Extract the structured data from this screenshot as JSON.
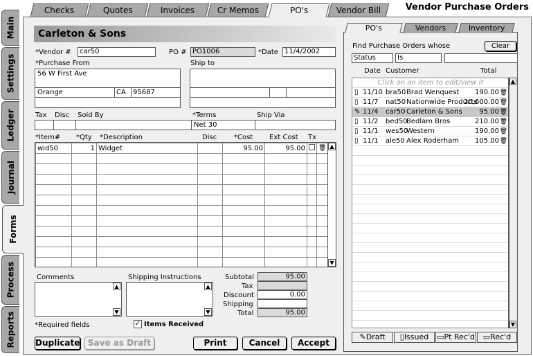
{
  "top_tabs": [
    {
      "label": "Checks"
    },
    {
      "label": "Quotes"
    },
    {
      "label": "Invoices"
    },
    {
      "label": "Cr Memos"
    },
    {
      "label": "PO's"
    },
    {
      "label": "Vendor Bill"
    }
  ],
  "app_title": "Vendor Purchase Orders",
  "side_tabs": [
    {
      "label": "Main"
    },
    {
      "label": "Settings"
    },
    {
      "label": "Ledger"
    },
    {
      "label": "Journal"
    },
    {
      "label": "Forms"
    },
    {
      "label": "Process"
    },
    {
      "label": "Reports"
    }
  ],
  "form": {
    "vendor_name": "Carleton & Sons",
    "vendor_label": "*Vendor #",
    "vendor_value": "car50",
    "po_label": "PO #",
    "po_value": "PO1006",
    "date_label": "*Date",
    "date_value": "11/4/2002",
    "purchase_from_label": "*Purchase From",
    "address1": "56 W First Ave",
    "city": "Orange",
    "state": "CA",
    "zip": "95687",
    "ship_to_label": "Ship to",
    "tax_label": "Tax",
    "disc_label": "Disc",
    "sold_by_label": "Sold By",
    "terms_label": "*Terms",
    "terms_value": "Net 30",
    "ship_via_label": "Ship Via",
    "columns": {
      "item": "*Item#",
      "qty": "*Qty",
      "desc": "*Description",
      "disc": "Disc",
      "cost": "*Cost",
      "ext": "Ext Cost",
      "tx": "Tx"
    },
    "lines": [
      {
        "item": "wid50",
        "qty": "1",
        "desc": "Widget",
        "disc": "",
        "cost": "95.00",
        "ext": "95.00"
      }
    ],
    "comments_label": "Comments",
    "shipping_instr_label": "Shipping Instructions",
    "subtotal_label": "Subtotal",
    "subtotal": "95.00",
    "tax_total_label": "Tax",
    "tax_total": "",
    "discount_label": "Discount",
    "discount": "0.00",
    "shipping_label": "Shipping",
    "shipping": "",
    "total_label": "Total",
    "total": "95.00",
    "required_note": "*Required fields",
    "items_received_label": "Items Received",
    "items_received_check": "✓"
  },
  "buttons": {
    "duplicate": "Duplicate",
    "save_draft": "Save as Draft",
    "print": "Print",
    "cancel": "Cancel",
    "accept": "Accept"
  },
  "right": {
    "tabs": [
      {
        "label": "PO's"
      },
      {
        "label": "Vendors"
      },
      {
        "label": "Inventory"
      }
    ],
    "find_label": "Find Purchase Orders whose",
    "clear": "Clear",
    "filter_field": "Status",
    "filter_op": "Is",
    "filter_value": "",
    "col_date": "Date",
    "col_customer": "Customer",
    "col_total": "Total",
    "hint": "Click on an item to edit/view it",
    "rows": [
      {
        "date": "11/10",
        "code": "bra50",
        "name": "Brad Wenquest",
        "total": "190.00",
        "selected": false
      },
      {
        "date": "11/7",
        "code": "nat50",
        "name": "Nationwide Products",
        "total": "20,600.00",
        "selected": false
      },
      {
        "date": "11/4",
        "code": "car50",
        "name": "Carleton & Sons",
        "total": "95.00",
        "selected": true
      },
      {
        "date": "11/2",
        "code": "bed50",
        "name": "Bedlam Bros",
        "total": "210.00",
        "selected": false
      },
      {
        "date": "11/1",
        "code": "wes50",
        "name": "Western",
        "total": "190.00",
        "selected": false
      },
      {
        "date": "11/1",
        "code": "ale50",
        "name": "Alex Roderham",
        "total": "105.00",
        "selected": false
      }
    ],
    "bottom_tabs": [
      {
        "label": "Draft"
      },
      {
        "label": "Issued"
      },
      {
        "label": "Pt Rec'd"
      },
      {
        "label": "Rec'd"
      }
    ]
  }
}
